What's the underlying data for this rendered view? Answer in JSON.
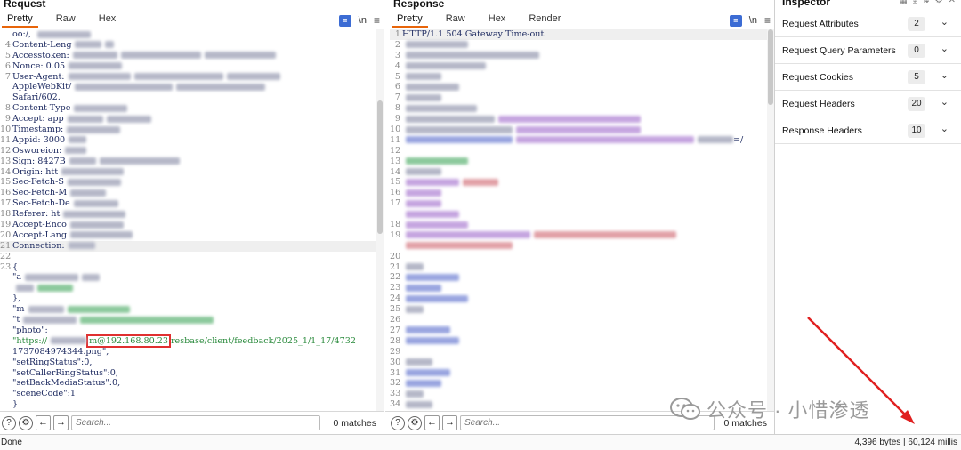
{
  "request": {
    "title": "Request",
    "tabs": [
      "Pretty",
      "Raw",
      "Hex"
    ],
    "tools": {
      "wrap": "≡",
      "newline": "\\n",
      "menu": "≡"
    },
    "lines": [
      {
        "n": "",
        "t": "oo:/, ",
        "b": [
          {
            "c": "b-gray",
            "w": 60
          }
        ]
      },
      {
        "n": "4",
        "t": "Content-Leng",
        "b": [
          {
            "c": "b-gray",
            "w": 30
          },
          {
            "c": "b-gray",
            "w": 10
          }
        ]
      },
      {
        "n": "5",
        "t": "Accesstoken:",
        "b": [
          {
            "c": "b-gray",
            "w": 50
          },
          {
            "c": "b-gray",
            "w": 90
          },
          {
            "c": "b-gray",
            "w": 80
          }
        ]
      },
      {
        "n": "6",
        "t": "Nonce: 0.05",
        "b": [
          {
            "c": "b-gray",
            "w": 60
          }
        ]
      },
      {
        "n": "7",
        "t": "User-Agent:",
        "b": [
          {
            "c": "b-gray",
            "w": 70
          },
          {
            "c": "b-gray",
            "w": 100
          },
          {
            "c": "b-gray",
            "w": 60
          }
        ]
      },
      {
        "n": "",
        "t": "AppleWebKit/",
        "b": [
          {
            "c": "b-gray",
            "w": 110
          },
          {
            "c": "b-gray",
            "w": 100
          }
        ]
      },
      {
        "n": "",
        "t": "Safari/602.",
        "b": []
      },
      {
        "n": "8",
        "t": "Content-Type",
        "b": [
          {
            "c": "b-gray",
            "w": 60
          }
        ]
      },
      {
        "n": "9",
        "t": "Accept: app",
        "b": [
          {
            "c": "b-gray",
            "w": 40
          },
          {
            "c": "b-gray",
            "w": 50
          }
        ]
      },
      {
        "n": "10",
        "t": "Timestamp:",
        "b": [
          {
            "c": "b-gray",
            "w": 60
          }
        ]
      },
      {
        "n": "11",
        "t": "Appid: 3000",
        "b": [
          {
            "c": "b-gray",
            "w": 20
          }
        ]
      },
      {
        "n": "12",
        "t": "Osworeion:",
        "b": [
          {
            "c": "b-gray",
            "w": 24
          }
        ]
      },
      {
        "n": "13",
        "t": "Sign: 8427B",
        "b": [
          {
            "c": "b-gray",
            "w": 30
          },
          {
            "c": "b-gray",
            "w": 90
          }
        ]
      },
      {
        "n": "14",
        "t": "Origin: htt",
        "b": [
          {
            "c": "b-gray",
            "w": 70
          }
        ]
      },
      {
        "n": "15",
        "t": "Sec-Fetch-S",
        "b": [
          {
            "c": "b-gray",
            "w": 60
          }
        ]
      },
      {
        "n": "16",
        "t": "Sec-Fetch-M",
        "b": [
          {
            "c": "b-gray",
            "w": 40
          }
        ]
      },
      {
        "n": "17",
        "t": "Sec-Fetch-De",
        "b": [
          {
            "c": "b-gray",
            "w": 50
          }
        ]
      },
      {
        "n": "18",
        "t": "Referer: ht",
        "b": [
          {
            "c": "b-gray",
            "w": 70
          }
        ]
      },
      {
        "n": "19",
        "t": "Accept-Enco",
        "b": [
          {
            "c": "b-gray",
            "w": 60
          }
        ]
      },
      {
        "n": "20",
        "t": "Accept-Lang",
        "b": [
          {
            "c": "b-gray",
            "w": 70
          }
        ]
      },
      {
        "n": "21",
        "t": "Connection:",
        "b": [
          {
            "c": "b-gray",
            "w": 30
          }
        ],
        "hl": true
      },
      {
        "n": "22",
        "t": "",
        "b": []
      },
      {
        "n": "23",
        "t": "{",
        "b": []
      },
      {
        "n": "",
        "t": "  \"a",
        "b": [
          {
            "c": "b-gray",
            "w": 60
          },
          {
            "c": "b-gray",
            "w": 20
          }
        ]
      },
      {
        "n": "",
        "t": "   ",
        "b": [
          {
            "c": "b-gray",
            "w": 20
          },
          {
            "c": "b-green",
            "w": 40
          }
        ]
      },
      {
        "n": "",
        "t": "  },",
        "b": []
      },
      {
        "n": "",
        "t": "  \"m",
        "b": [
          {
            "c": "b-gray",
            "w": 40
          },
          {
            "c": "b-green",
            "w": 70
          }
        ]
      },
      {
        "n": "",
        "t": "  \"t",
        "b": [
          {
            "c": "b-gray",
            "w": 60
          },
          {
            "c": "b-green",
            "w": 150
          }
        ]
      },
      {
        "n": "",
        "t": "  \"photo\":",
        "b": []
      }
    ],
    "photo_prefix": "  \"https://",
    "photo_highlight": "m@192.168.80.23",
    "photo_suffix": "resbase/client/feedback/2025_1/1_17/4732",
    "tail_lines": [
      {
        "n": "",
        "t": "  1737084974344.png\","
      },
      {
        "n": "",
        "t": "  \"setRingStatus\":0,"
      },
      {
        "n": "",
        "t": "  \"setCallerRingStatus\":0,"
      },
      {
        "n": "",
        "t": "  \"setBackMediaStatus\":0,"
      },
      {
        "n": "",
        "t": "  \"sceneCode\":1"
      },
      {
        "n": "",
        "t": "}"
      }
    ],
    "search_placeholder": "Search...",
    "matches": "0 matches"
  },
  "response": {
    "title": "Response",
    "tabs": [
      "Pretty",
      "Raw",
      "Hex",
      "Render"
    ],
    "tools": {
      "wrap": "≡",
      "newline": "\\n",
      "menu": "≡"
    },
    "first_line": "HTTP/1.1 504 Gateway Time-out",
    "line_numbers": [
      "1",
      "2",
      "3",
      "4",
      "5",
      "6",
      "7",
      "8",
      "9",
      "10",
      "11",
      "12",
      "13",
      "14",
      "15",
      "16",
      "17",
      "",
      "18",
      "19",
      "",
      "20",
      "21",
      "22",
      "23",
      "24",
      "25",
      "26",
      "27",
      "28",
      "29",
      "30",
      "31",
      "32",
      "33",
      "34"
    ],
    "line11_tail": "=/",
    "search_placeholder": "Search...",
    "matches": "0 matches"
  },
  "inspector": {
    "title": "Inspector",
    "rows": [
      {
        "label": "Request Attributes",
        "count": "2"
      },
      {
        "label": "Request Query Parameters",
        "count": "0"
      },
      {
        "label": "Request Cookies",
        "count": "5"
      },
      {
        "label": "Request Headers",
        "count": "20"
      },
      {
        "label": "Response Headers",
        "count": "10"
      }
    ]
  },
  "status": {
    "left": "Done",
    "right": "4,396 bytes | 60,124 millis"
  },
  "watermark": "公众号 · 小惜渗透",
  "colors": {
    "accent": "#e8650a",
    "highlight_box": "#e03030",
    "arrow": "#e02020"
  }
}
